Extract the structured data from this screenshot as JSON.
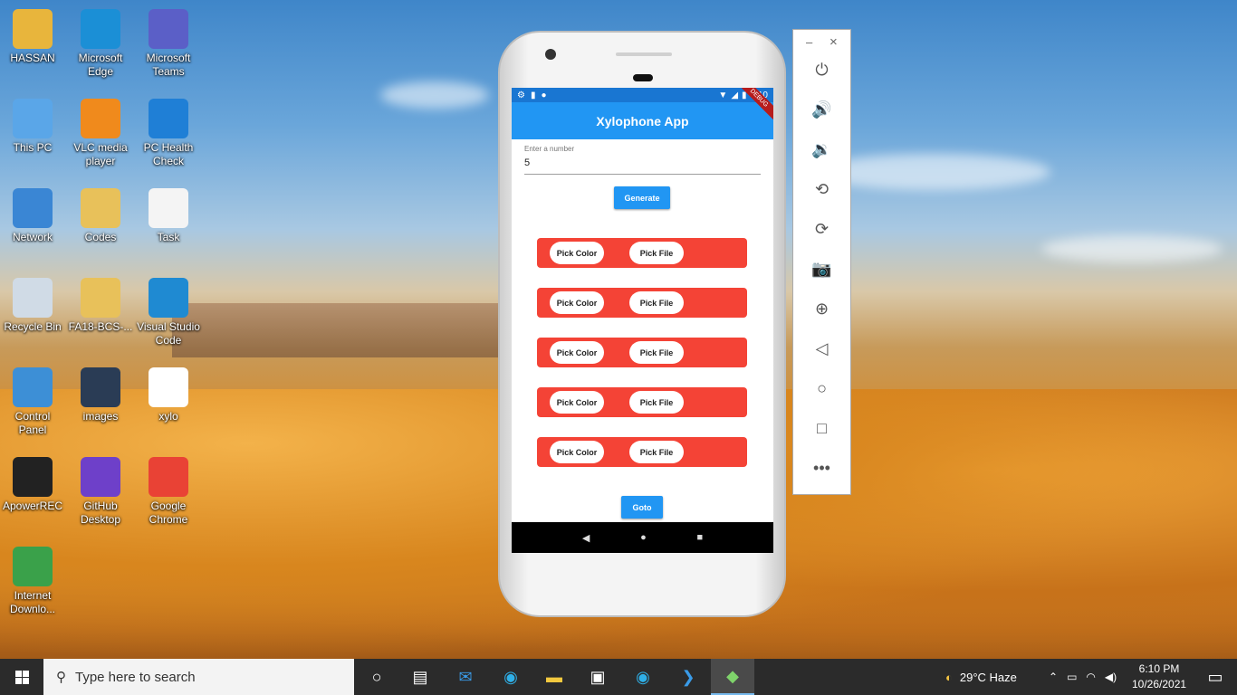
{
  "desktop_icons": [
    {
      "label": "HASSAN",
      "icon": "user-folder-icon",
      "color": "#e8b53c"
    },
    {
      "label": "Microsoft Edge",
      "icon": "edge-icon",
      "color": "#1b8fd6"
    },
    {
      "label": "Microsoft Teams",
      "icon": "teams-icon",
      "color": "#5b5fc7"
    },
    {
      "label": "This PC",
      "icon": "computer-icon",
      "color": "#5aa6e8"
    },
    {
      "label": "VLC media player",
      "icon": "vlc-icon",
      "color": "#f08a1c"
    },
    {
      "label": "PC Health Check",
      "icon": "health-check-icon",
      "color": "#1f7fd6"
    },
    {
      "label": "Network",
      "icon": "network-icon",
      "color": "#3a86d4"
    },
    {
      "label": "Codes",
      "icon": "folder-icon",
      "color": "#e8c15a"
    },
    {
      "label": "Task",
      "icon": "python-file-icon",
      "color": "#f4f4f4"
    },
    {
      "label": "Recycle Bin",
      "icon": "recycle-bin-icon",
      "color": "#d0dbe6"
    },
    {
      "label": "FA18-BCS-...",
      "icon": "folder-icon",
      "color": "#e8c15a"
    },
    {
      "label": "Visual Studio Code",
      "icon": "vscode-icon",
      "color": "#1f8ad2"
    },
    {
      "label": "Control Panel",
      "icon": "control-panel-icon",
      "color": "#3d8fd6"
    },
    {
      "label": "images",
      "icon": "folder-icon",
      "color": "#2a3c55"
    },
    {
      "label": "xylo",
      "icon": "image-file-icon",
      "color": "#ffffff"
    },
    {
      "label": "ApowerREC",
      "icon": "apowerrec-icon",
      "color": "#222222"
    },
    {
      "label": "GitHub Desktop",
      "icon": "github-icon",
      "color": "#6e40c9"
    },
    {
      "label": "Google Chrome",
      "icon": "chrome-icon",
      "color": "#e94235"
    },
    {
      "label": "Internet Downlo...",
      "icon": "idm-icon",
      "color": "#3aa14a"
    }
  ],
  "emulator": {
    "status_time": "6:10",
    "debug_banner": "DEBUG",
    "app_title": "Xylophone App",
    "input": {
      "label": "Enter a number",
      "value": "5"
    },
    "generate_label": "Generate",
    "rows": [
      {
        "color_label": "Pick Color",
        "file_label": "Pick File"
      },
      {
        "color_label": "Pick Color",
        "file_label": "Pick File"
      },
      {
        "color_label": "Pick Color",
        "file_label": "Pick File"
      },
      {
        "color_label": "Pick Color",
        "file_label": "Pick File"
      },
      {
        "color_label": "Pick Color",
        "file_label": "Pick File"
      }
    ],
    "goto_label": "Goto",
    "nav": {
      "back": "◀",
      "home": "●",
      "recents": "■"
    },
    "accent": "#2196f3",
    "row_color": "#f44336"
  },
  "side_panel": {
    "minimize": "–",
    "close": "×",
    "tools": [
      {
        "name": "power-icon",
        "glyph": "⏻"
      },
      {
        "name": "volume-up-icon",
        "glyph": "🔊"
      },
      {
        "name": "volume-down-icon",
        "glyph": "🔉"
      },
      {
        "name": "rotate-left-icon",
        "glyph": "⟲"
      },
      {
        "name": "rotate-right-icon",
        "glyph": "⟳"
      },
      {
        "name": "camera-icon",
        "glyph": "📷"
      },
      {
        "name": "zoom-icon",
        "glyph": "⊕"
      },
      {
        "name": "back-icon",
        "glyph": "◁"
      },
      {
        "name": "home-icon",
        "glyph": "○"
      },
      {
        "name": "overview-icon",
        "glyph": "□"
      },
      {
        "name": "more-icon",
        "glyph": "•••"
      }
    ]
  },
  "taskbar": {
    "search_placeholder": "Type here to search",
    "weather": "29°C  Haze",
    "time": "6:10 PM",
    "date": "10/26/2021"
  }
}
